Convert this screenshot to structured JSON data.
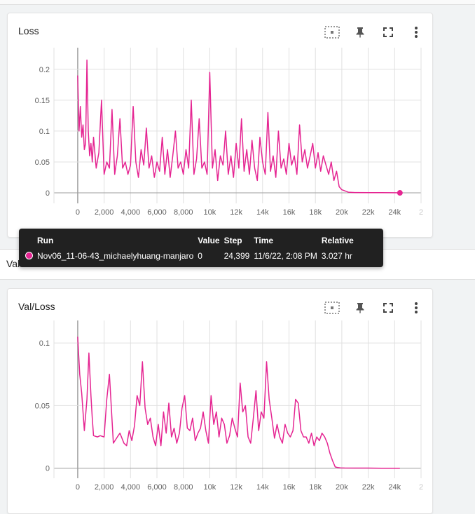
{
  "colors": {
    "series": "#e52592",
    "grid": "#e0e0e0",
    "axis_text": "#616161"
  },
  "icons": [
    "fit-domain-icon",
    "pin-icon",
    "fullscreen-icon",
    "more-vert-icon"
  ],
  "section": {
    "label": "Val"
  },
  "tooltip": {
    "headers": {
      "run": "Run",
      "value": "Value",
      "step": "Step",
      "time": "Time",
      "relative": "Relative"
    },
    "row": {
      "run": "Nov06_11-06-43_michaelyhuang-manjaro",
      "value": "0",
      "step": "24,399",
      "time": "11/6/22, 2:08 PM",
      "relative": "3.027 hr"
    }
  },
  "cards": [
    {
      "title": "Loss"
    },
    {
      "title": "Val/Loss"
    }
  ],
  "chart_data": [
    {
      "type": "line",
      "title": "Loss",
      "xlim": [
        -1800,
        26000
      ],
      "ylim": [
        -0.017,
        0.235
      ],
      "x_ticks": [
        -2000,
        0,
        2000,
        4000,
        6000,
        8000,
        10000,
        12000,
        14000,
        16000,
        18000,
        20000,
        22000,
        24000,
        26000
      ],
      "x_tick_labels": [
        "00",
        "0",
        "2,000",
        "4,000",
        "6,000",
        "8,000",
        "10k",
        "12k",
        "14k",
        "16k",
        "18k",
        "20k",
        "22k",
        "24k",
        "2"
      ],
      "y_ticks": [
        0,
        0.05,
        0.1,
        0.15,
        0.2
      ],
      "y_tick_labels": [
        "0",
        "0.05",
        "0.1",
        "0.15",
        "0.2"
      ],
      "grid": true,
      "highlight_point": [
        24399,
        0
      ],
      "series": [
        {
          "x": [
            0,
            100,
            200,
            300,
            400,
            500,
            600,
            700,
            800,
            900,
            1000,
            1100,
            1200,
            1400,
            1600,
            1800,
            2000,
            2200,
            2400,
            2600,
            2800,
            3000,
            3200,
            3400,
            3600,
            3800,
            4000,
            4200,
            4400,
            4600,
            4800,
            5000,
            5200,
            5400,
            5600,
            5800,
            6000,
            6200,
            6400,
            6600,
            6800,
            7000,
            7200,
            7400,
            7600,
            7800,
            8000,
            8200,
            8400,
            8600,
            8800,
            9000,
            9200,
            9400,
            9600,
            9800,
            10000,
            10200,
            10400,
            10600,
            10800,
            11000,
            11200,
            11400,
            11600,
            11800,
            12000,
            12200,
            12400,
            12600,
            12800,
            13000,
            13200,
            13400,
            13600,
            13800,
            14000,
            14200,
            14400,
            14600,
            14800,
            15000,
            15200,
            15400,
            15600,
            15800,
            16000,
            16200,
            16400,
            16600,
            16800,
            17000,
            17200,
            17400,
            17600,
            17800,
            18000,
            18200,
            18400,
            18600,
            18800,
            19000,
            19200,
            19400,
            19600,
            19800,
            20000,
            20500,
            21000,
            22000,
            23000,
            24000,
            24399
          ],
          "values": [
            0.19,
            0.1,
            0.14,
            0.09,
            0.11,
            0.07,
            0.08,
            0.215,
            0.1,
            0.06,
            0.08,
            0.05,
            0.09,
            0.04,
            0.065,
            0.15,
            0.03,
            0.05,
            0.04,
            0.135,
            0.03,
            0.06,
            0.12,
            0.04,
            0.05,
            0.03,
            0.045,
            0.14,
            0.05,
            0.025,
            0.07,
            0.045,
            0.105,
            0.04,
            0.06,
            0.025,
            0.05,
            0.035,
            0.09,
            0.03,
            0.07,
            0.025,
            0.06,
            0.1,
            0.04,
            0.05,
            0.03,
            0.07,
            0.04,
            0.15,
            0.03,
            0.055,
            0.12,
            0.04,
            0.05,
            0.03,
            0.195,
            0.04,
            0.07,
            0.02,
            0.06,
            0.045,
            0.1,
            0.03,
            0.06,
            0.025,
            0.08,
            0.04,
            0.12,
            0.035,
            0.07,
            0.03,
            0.085,
            0.04,
            0.02,
            0.09,
            0.05,
            0.03,
            0.13,
            0.035,
            0.06,
            0.025,
            0.1,
            0.04,
            0.055,
            0.03,
            0.08,
            0.045,
            0.06,
            0.03,
            0.11,
            0.05,
            0.07,
            0.04,
            0.06,
            0.08,
            0.04,
            0.065,
            0.035,
            0.06,
            0.045,
            0.03,
            0.05,
            0.02,
            0.035,
            0.01,
            0.005,
            0.001,
            0.0005,
            0.0003,
            0.0002,
            0.0001,
            0.0
          ]
        }
      ]
    },
    {
      "type": "line",
      "title": "Val/Loss",
      "xlim": [
        -1800,
        26000
      ],
      "ylim": [
        -0.008,
        0.118
      ],
      "x_ticks": [
        -2000,
        0,
        2000,
        4000,
        6000,
        8000,
        10000,
        12000,
        14000,
        16000,
        18000,
        20000,
        22000,
        24000,
        26000
      ],
      "x_tick_labels": [
        "00",
        "0",
        "2,000",
        "4,000",
        "6,000",
        "8,000",
        "10k",
        "12k",
        "14k",
        "16k",
        "18k",
        "20k",
        "22k",
        "24k",
        "2"
      ],
      "y_ticks": [
        0,
        0.05,
        0.1
      ],
      "y_tick_labels": [
        "0",
        "0.05",
        "0.1"
      ],
      "grid": true,
      "series": [
        {
          "x": [
            0,
            150,
            300,
            500,
            700,
            850,
            1000,
            1100,
            1200,
            1500,
            1700,
            2000,
            2200,
            2400,
            2700,
            3000,
            3200,
            3500,
            3700,
            3900,
            4100,
            4300,
            4500,
            4700,
            4900,
            5100,
            5300,
            5500,
            5700,
            5900,
            6100,
            6300,
            6500,
            6700,
            6900,
            7100,
            7300,
            7500,
            7700,
            7900,
            8100,
            8300,
            8500,
            8700,
            8900,
            9100,
            9300,
            9500,
            9700,
            9900,
            10100,
            10300,
            10500,
            10700,
            10900,
            11100,
            11300,
            11500,
            11700,
            11900,
            12100,
            12300,
            12500,
            12700,
            12900,
            13100,
            13300,
            13500,
            13700,
            13900,
            14100,
            14300,
            14500,
            14700,
            14900,
            15100,
            15300,
            15500,
            15700,
            15900,
            16100,
            16300,
            16500,
            16700,
            16900,
            17100,
            17300,
            17500,
            17700,
            17900,
            18100,
            18300,
            18500,
            18700,
            18900,
            19100,
            19300,
            19500,
            19700,
            19900,
            20200,
            21000,
            22000,
            23000,
            24000,
            24399
          ],
          "values": [
            0.105,
            0.075,
            0.06,
            0.03,
            0.055,
            0.092,
            0.058,
            0.04,
            0.026,
            0.025,
            0.026,
            0.025,
            0.055,
            0.075,
            0.02,
            0.025,
            0.028,
            0.02,
            0.018,
            0.03,
            0.022,
            0.034,
            0.058,
            0.05,
            0.085,
            0.048,
            0.035,
            0.04,
            0.025,
            0.018,
            0.035,
            0.018,
            0.045,
            0.028,
            0.052,
            0.025,
            0.032,
            0.02,
            0.028,
            0.048,
            0.058,
            0.032,
            0.03,
            0.04,
            0.022,
            0.028,
            0.032,
            0.045,
            0.03,
            0.02,
            0.058,
            0.035,
            0.045,
            0.025,
            0.04,
            0.035,
            0.02,
            0.026,
            0.04,
            0.032,
            0.025,
            0.068,
            0.045,
            0.05,
            0.025,
            0.02,
            0.04,
            0.062,
            0.03,
            0.045,
            0.04,
            0.085,
            0.055,
            0.04,
            0.024,
            0.035,
            0.025,
            0.02,
            0.035,
            0.028,
            0.025,
            0.03,
            0.055,
            0.052,
            0.03,
            0.025,
            0.025,
            0.02,
            0.028,
            0.018,
            0.025,
            0.022,
            0.028,
            0.025,
            0.02,
            0.012,
            0.006,
            0.001,
            0.0005,
            0.0003,
            0.0002,
            0.0001,
            0.0001,
            0.0,
            0.0,
            0.0
          ]
        }
      ]
    }
  ]
}
